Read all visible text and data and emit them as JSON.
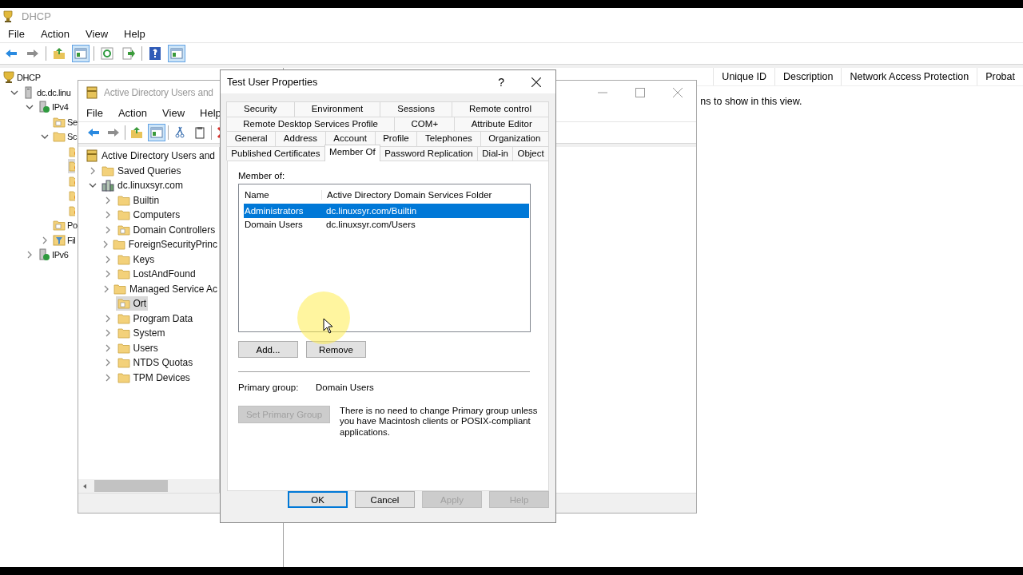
{
  "dhcp": {
    "title": "DHCP",
    "menu": [
      "File",
      "Action",
      "View",
      "Help"
    ],
    "toolbar": [
      [
        {
          "kind": "back",
          "pressed": false
        },
        {
          "kind": "forward",
          "pressed": false
        }
      ],
      [
        {
          "kind": "up",
          "pressed": false
        },
        {
          "kind": "pane",
          "pressed": true
        }
      ],
      [
        {
          "kind": "refresh",
          "pressed": false
        },
        {
          "kind": "export",
          "pressed": false
        }
      ],
      [
        {
          "kind": "help",
          "pressed": false
        },
        {
          "kind": "pane",
          "pressed": true
        }
      ]
    ],
    "tree": [
      {
        "label": "DHCP",
        "kind": "dhcp",
        "selected": false,
        "children": [
          {
            "label": "dc.dc.linu",
            "kind": "server",
            "expanded": true,
            "selected": false,
            "children": [
              {
                "label": "IPv4",
                "kind": "network",
                "expanded": true,
                "selected": false,
                "children": [
                  {
                    "label": "Se",
                    "kind": "folder-doc",
                    "selected": false
                  },
                  {
                    "label": "Sc",
                    "kind": "folder",
                    "expanded": true,
                    "selected": false,
                    "children": [
                      {
                        "kind": "scope-item",
                        "selected": false
                      },
                      {
                        "kind": "scope-item",
                        "selected": true
                      },
                      {
                        "kind": "scope-item",
                        "selected": false
                      },
                      {
                        "kind": "scope-item",
                        "selected": false
                      },
                      {
                        "kind": "scope-item",
                        "selected": false
                      }
                    ]
                  },
                  {
                    "label": "Po",
                    "kind": "folder-doc",
                    "selected": false
                  },
                  {
                    "label": "Fil",
                    "kind": "filter",
                    "expanded": false,
                    "selected": false
                  }
                ]
              },
              {
                "label": "IPv6",
                "kind": "network",
                "expanded": false,
                "selected": false
              }
            ]
          }
        ]
      }
    ],
    "columns": [
      "Unique ID",
      "Description",
      "Network Access Protection",
      "Probat"
    ],
    "empty_message": "ns to show in this view."
  },
  "ad": {
    "title": "Active Directory Users and",
    "menu": [
      "File",
      "Action",
      "View",
      "Help"
    ],
    "toolbar": [
      [
        {
          "kind": "back",
          "pressed": false
        },
        {
          "kind": "forward",
          "pressed": false
        }
      ],
      [
        {
          "kind": "up",
          "pressed": false
        },
        {
          "kind": "pane",
          "pressed": true
        }
      ],
      [
        {
          "kind": "cut",
          "pressed": false
        },
        {
          "kind": "paste",
          "pressed": false
        }
      ],
      [
        {
          "kind": "delete"
        }
      ]
    ],
    "tree": [
      {
        "label": "Active Directory Users and",
        "kind": "ad-root",
        "selected": false,
        "children": [
          {
            "label": "Saved Queries",
            "kind": "folder",
            "expanded": false,
            "selected": false
          },
          {
            "label": "dc.linuxsyr.com",
            "kind": "domain",
            "expanded": true,
            "selected": false,
            "children": [
              {
                "label": "Builtin",
                "kind": "folder",
                "expanded": false,
                "selected": false
              },
              {
                "label": "Computers",
                "kind": "folder",
                "expanded": false,
                "selected": false
              },
              {
                "label": "Domain Controllers",
                "kind": "folder-doc",
                "expanded": false,
                "selected": false
              },
              {
                "label": "ForeignSecurityPrinc",
                "kind": "folder",
                "expanded": false,
                "selected": false
              },
              {
                "label": "Keys",
                "kind": "folder",
                "expanded": false,
                "selected": false
              },
              {
                "label": "LostAndFound",
                "kind": "folder",
                "expanded": false,
                "selected": false
              },
              {
                "label": "Managed Service Ac",
                "kind": "folder",
                "expanded": false,
                "selected": false
              },
              {
                "label": "Ort",
                "kind": "folder-doc",
                "selected": true
              },
              {
                "label": "Program Data",
                "kind": "folder",
                "expanded": false,
                "selected": false
              },
              {
                "label": "System",
                "kind": "folder",
                "expanded": false,
                "selected": false
              },
              {
                "label": "Users",
                "kind": "folder",
                "expanded": false,
                "selected": false
              },
              {
                "label": "NTDS Quotas",
                "kind": "folder",
                "expanded": false,
                "selected": false
              },
              {
                "label": "TPM Devices",
                "kind": "folder",
                "expanded": false,
                "selected": false
              }
            ]
          }
        ]
      }
    ]
  },
  "dialog": {
    "title": "Test User Properties",
    "help_glyph": "?",
    "tab_rows": [
      [
        {
          "label": "Security",
          "selected": false
        },
        {
          "label": "Environment",
          "selected": false
        },
        {
          "label": "Sessions",
          "selected": false
        },
        {
          "label": "Remote control",
          "selected": false
        }
      ],
      [
        {
          "label": "Remote Desktop Services Profile",
          "selected": false
        },
        {
          "label": "COM+",
          "selected": false
        },
        {
          "label": "Attribute Editor",
          "selected": false
        }
      ],
      [
        {
          "label": "General",
          "selected": false
        },
        {
          "label": "Address",
          "selected": false
        },
        {
          "label": "Account",
          "selected": false
        },
        {
          "label": "Profile",
          "selected": false
        },
        {
          "label": "Telephones",
          "selected": false
        },
        {
          "label": "Organization",
          "selected": false
        }
      ],
      [
        {
          "label": "Published Certificates",
          "selected": false
        },
        {
          "label": "Member Of",
          "selected": true
        },
        {
          "label": "Password Replication",
          "selected": false
        },
        {
          "label": "Dial-in",
          "selected": false
        },
        {
          "label": "Object",
          "selected": false
        }
      ]
    ],
    "member_of_label": "Member of:",
    "member_columns": [
      "Name",
      "Active Directory Domain Services Folder"
    ],
    "members": [
      {
        "name": "Administrators",
        "folder": "dc.linuxsyr.com/Builtin",
        "selected": true
      },
      {
        "name": "Domain Users",
        "folder": "dc.linuxsyr.com/Users",
        "selected": false
      }
    ],
    "list_buttons": [
      {
        "label": "Add...",
        "disabled": false
      },
      {
        "label": "Remove",
        "disabled": false
      }
    ],
    "primary_group_label": "Primary group:",
    "primary_group": "Domain Users",
    "set_primary": {
      "label": "Set Primary Group",
      "disabled": true
    },
    "note": "There is no need to change Primary group unless you have Macintosh clients or POSIX-compliant applications.",
    "buttons": [
      {
        "label": "OK",
        "disabled": false,
        "default": true
      },
      {
        "label": "Cancel",
        "disabled": false,
        "default": false
      },
      {
        "label": "Apply",
        "disabled": true,
        "default": false
      },
      {
        "label": "Help",
        "disabled": true,
        "default": false
      }
    ]
  }
}
